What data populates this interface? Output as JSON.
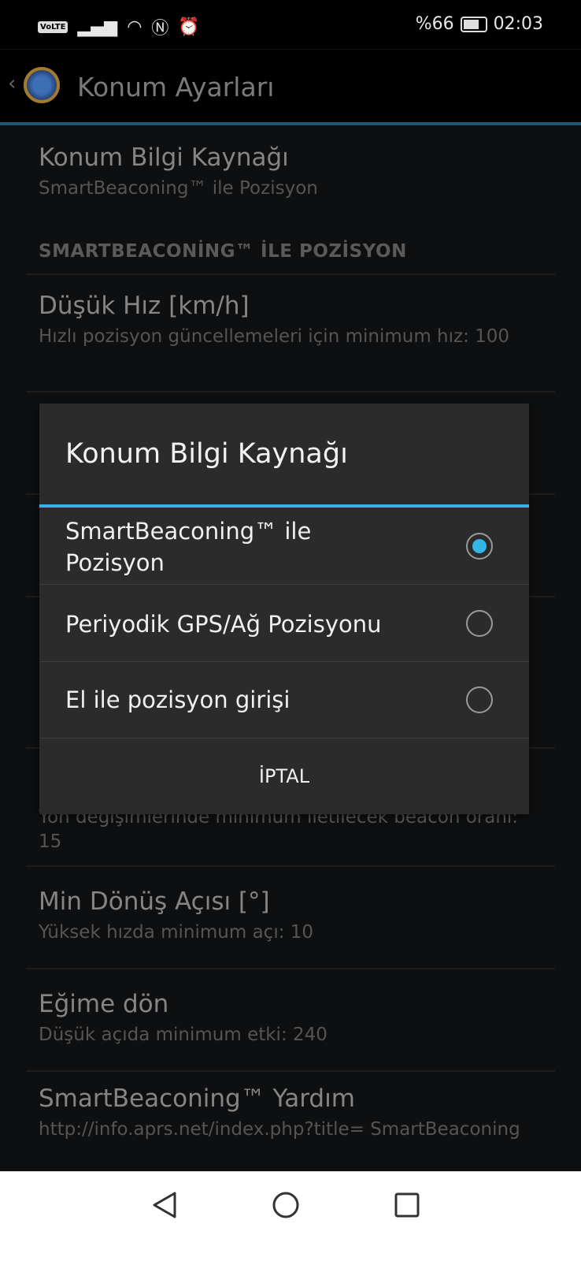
{
  "status": {
    "volte": "VoLTE",
    "battery": "%66",
    "battery_level": 66,
    "time": "02:03"
  },
  "header": {
    "title": "Konum Ayarları"
  },
  "prefs": {
    "source": {
      "title": "Konum Bilgi Kaynağı",
      "summary": "SmartBeaconing™ ile Pozisyon"
    },
    "section": "SMARTBEACONİNG™ İLE POZİSYON",
    "low_speed": {
      "title": "Düşük Hız [km/h]",
      "summary": "Hızlı pozisyon güncellemeleri için minimum hız: 100"
    },
    "turn_rate": {
      "summary": "Yön değişimlerinde minimum iletilecek beacon oranı: 15"
    },
    "min_turn": {
      "title": "Min Dönüş Açısı [°]",
      "summary": "Yüksek hızda minimum açı: 10"
    },
    "slope": {
      "title": "Eğime dön",
      "summary": "Düşük açıda minimum etki: 240"
    },
    "help": {
      "title": "SmartBeaconing™ Yardım",
      "summary": "http://info.aprs.net/index.php?title= SmartBeaconing"
    }
  },
  "dialog": {
    "title": "Konum Bilgi Kaynağı",
    "options": [
      {
        "label": "SmartBeaconing™ ile Pozisyon",
        "selected": true
      },
      {
        "label": "Periyodik GPS/Ağ Pozisyonu",
        "selected": false
      },
      {
        "label": "El ile pozisyon girişi",
        "selected": false
      }
    ],
    "cancel": "İPTAL"
  }
}
